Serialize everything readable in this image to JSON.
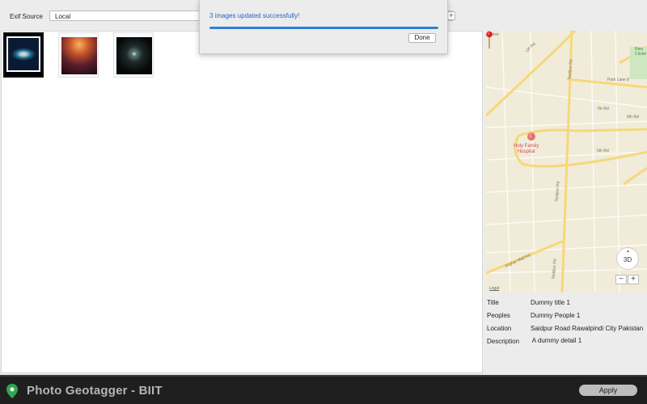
{
  "toolbar": {
    "exif_source_label": "Exif Source",
    "exif_source_value": "Local",
    "add_label": "+"
  },
  "images": [
    {
      "name": "galaxy",
      "selected": true
    },
    {
      "name": "crowd-night",
      "selected": false
    },
    {
      "name": "dark-corridor",
      "selected": false
    }
  ],
  "map": {
    "labels": {
      "street_top": "Stree",
      "up_rd": "UP Rd",
      "saidpur_rd_top": "Saidpur Rd",
      "rawalpindi_cricket": "Raw\nCricke",
      "park_lane": "Park Lane 8",
      "seventh_rd": "7th Rd",
      "sixth_rd": "6th Rd",
      "fifth_rd": "5th Rd",
      "hospital": "Holy Family\nHospital",
      "saidpur_rd_mid": "Saidpur Rd",
      "saidpur_rd_bottom": "Saidpur Rd",
      "asghar_mall_rd": "Asghar Mall Rd",
      "legal": "Legal"
    },
    "compass_label": "3D",
    "zoom_out_label": "−",
    "zoom_in_label": "+"
  },
  "details": [
    {
      "label": "Title",
      "value": "Dummy title 1"
    },
    {
      "label": "Peoples",
      "value": "Dummy People 1"
    },
    {
      "label": "Location",
      "value": "Saidpur Road Rawalpindi City Pakistan"
    },
    {
      "label": "Description",
      "value": " A dummy detail 1"
    }
  ],
  "bottom_bar": {
    "app_title": "Photo Geotagger - BIIT",
    "apply_label": "Apply"
  },
  "modal": {
    "message": "3 images updated successfully!",
    "progress": 1.0,
    "done_label": "Done"
  },
  "colors": {
    "accent": "#2e7fd8",
    "message_text": "#1f63c8",
    "app_icon": "#2fa84f"
  }
}
